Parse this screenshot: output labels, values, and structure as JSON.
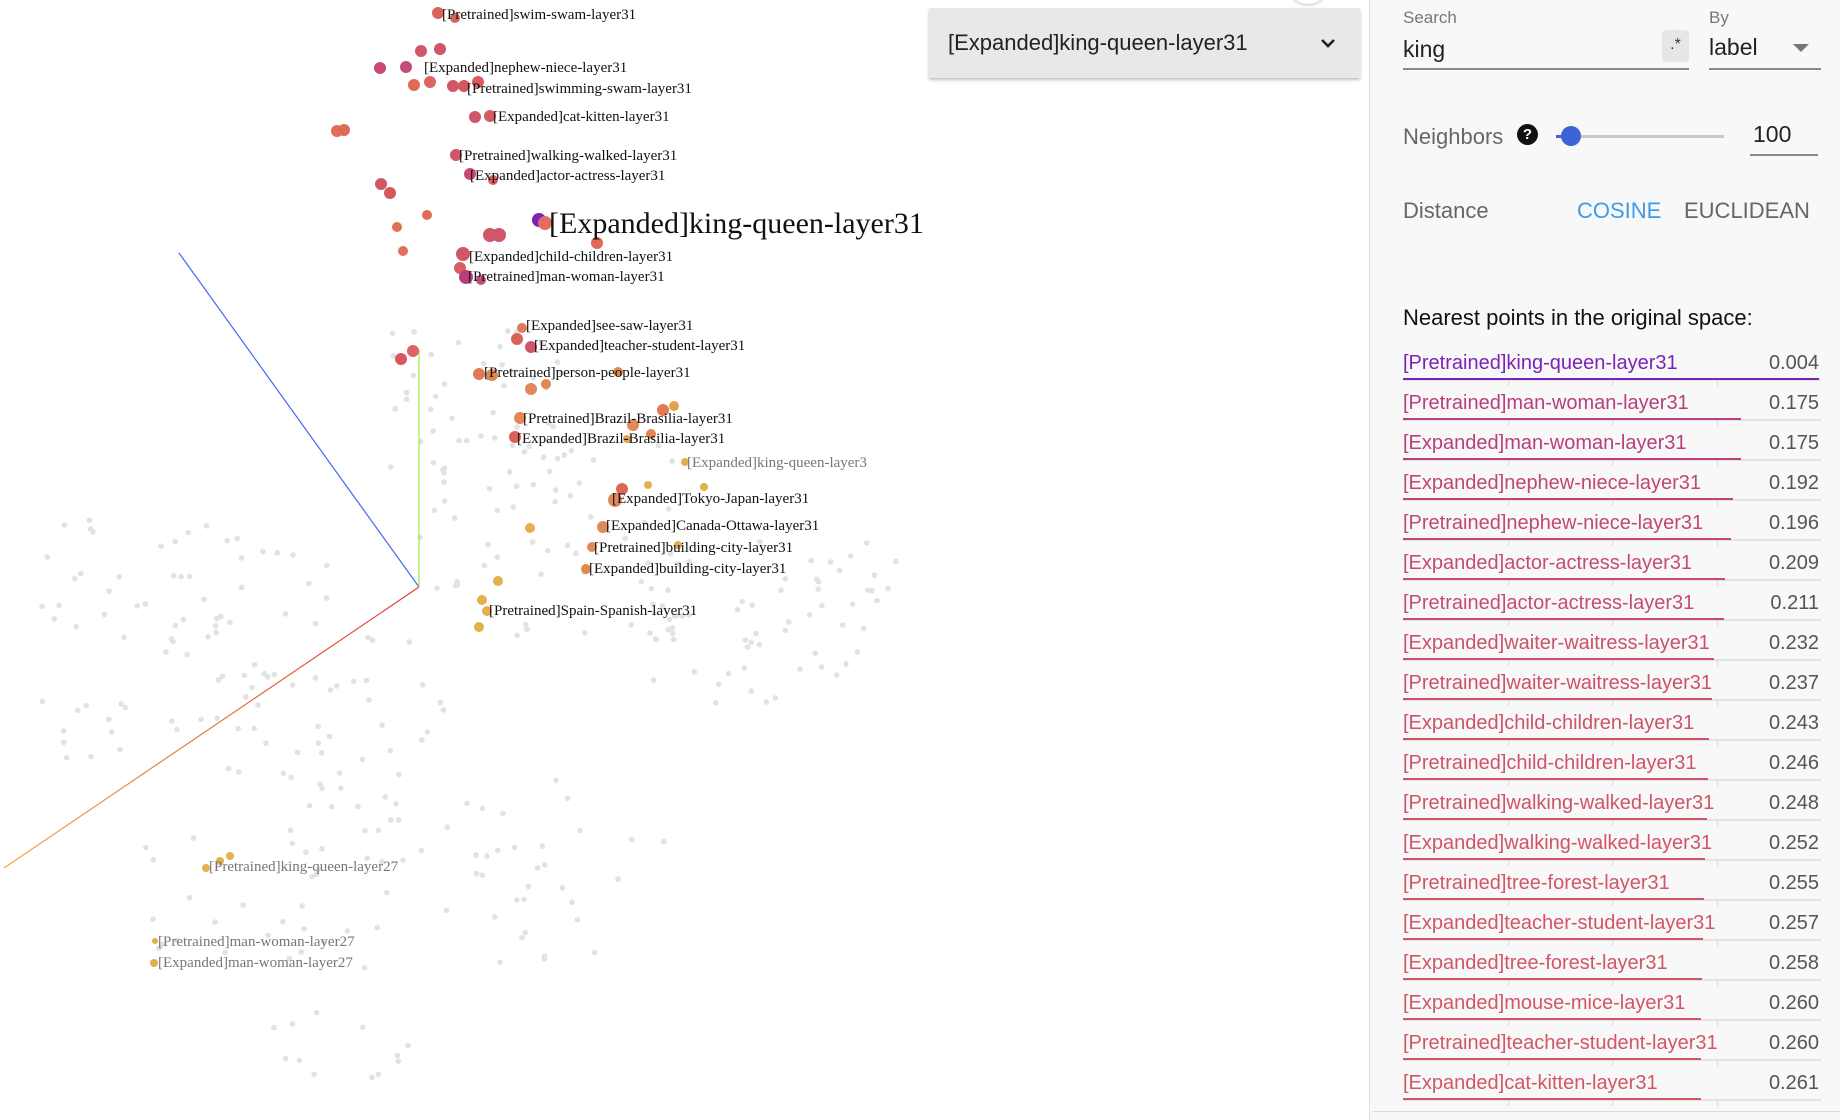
{
  "selected_point": "[Expanded]king-queen-layer31",
  "search": {
    "label": "Search",
    "value": "king",
    "regex_toggle": ".*",
    "by_label": "By",
    "by_value": "label"
  },
  "neighbors": {
    "label": "Neighbors",
    "help_icon": "?",
    "value": "100",
    "slider_fraction": 0.09
  },
  "distance": {
    "label": "Distance",
    "options": [
      "COSINE",
      "EUCLIDEAN"
    ],
    "selected": "COSINE"
  },
  "nearest": {
    "title": "Nearest points in the original space:",
    "max_distance_scale": 1.1,
    "items": [
      {
        "label": "[Pretrained]king-queen-layer31",
        "value": "0.004",
        "color": "#7b22b8"
      },
      {
        "label": "[Pretrained]man-woman-layer31",
        "value": "0.175",
        "color": "#b83e7c"
      },
      {
        "label": "[Expanded]man-woman-layer31",
        "value": "0.175",
        "color": "#b83e7c"
      },
      {
        "label": "[Expanded]nephew-niece-layer31",
        "value": "0.192",
        "color": "#bf4677"
      },
      {
        "label": "[Pretrained]nephew-niece-layer31",
        "value": "0.196",
        "color": "#c04876"
      },
      {
        "label": "[Expanded]actor-actress-layer31",
        "value": "0.209",
        "color": "#c44c72"
      },
      {
        "label": "[Pretrained]actor-actress-layer31",
        "value": "0.211",
        "color": "#c54d71"
      },
      {
        "label": "[Expanded]waiter-waitress-layer31",
        "value": "0.232",
        "color": "#cb516c"
      },
      {
        "label": "[Pretrained]waiter-waitress-layer31",
        "value": "0.237",
        "color": "#cc526b"
      },
      {
        "label": "[Expanded]child-children-layer31",
        "value": "0.243",
        "color": "#ce536a"
      },
      {
        "label": "[Pretrained]child-children-layer31",
        "value": "0.246",
        "color": "#cf5469"
      },
      {
        "label": "[Pretrained]walking-walked-layer31",
        "value": "0.248",
        "color": "#cf5469"
      },
      {
        "label": "[Expanded]walking-walked-layer31",
        "value": "0.252",
        "color": "#d05568"
      },
      {
        "label": "[Pretrained]tree-forest-layer31",
        "value": "0.255",
        "color": "#d15667"
      },
      {
        "label": "[Expanded]teacher-student-layer31",
        "value": "0.257",
        "color": "#d15667"
      },
      {
        "label": "[Expanded]tree-forest-layer31",
        "value": "0.258",
        "color": "#d15667"
      },
      {
        "label": "[Expanded]mouse-mice-layer31",
        "value": "0.260",
        "color": "#d25766"
      },
      {
        "label": "[Pretrained]teacher-student-layer31",
        "value": "0.260",
        "color": "#d25766"
      },
      {
        "label": "[Expanded]cat-kitten-layer31",
        "value": "0.261",
        "color": "#d25766"
      }
    ]
  },
  "projection_labels": [
    {
      "text": "[Pretrained]swim-swam-layer31",
      "style": "normal"
    },
    {
      "text": "[Expanded]nephew-niece-layer31",
      "style": "normal"
    },
    {
      "text": "[Pretrained]swimming-swam-layer31",
      "style": "normal"
    },
    {
      "text": "[Expanded]cat-kitten-layer31",
      "style": "normal"
    },
    {
      "text": "[Pretrained]walking-walked-layer31",
      "style": "normal"
    },
    {
      "text": "[Expanded]actor-actress-layer31",
      "style": "normal"
    },
    {
      "text": "[Expanded]king-queen-layer31",
      "style": "selected"
    },
    {
      "text": "[Expanded]child-children-layer31",
      "style": "normal"
    },
    {
      "text": "[Pretrained]man-woman-layer31",
      "style": "normal"
    },
    {
      "text": "[Expanded]see-saw-layer31",
      "style": "normal"
    },
    {
      "text": "[Expanded]teacher-student-layer31",
      "style": "normal"
    },
    {
      "text": "[Pretrained]person-people-layer31",
      "style": "normal"
    },
    {
      "text": "[Pretrained]Brazil-Brasilia-layer31",
      "style": "normal"
    },
    {
      "text": "[Expanded]Brazil-Brasilia-layer31",
      "style": "normal"
    },
    {
      "text": "[Expanded]king-queen-layer3",
      "style": "faded"
    },
    {
      "text": "[Expanded]Tokyo-Japan-layer31",
      "style": "normal"
    },
    {
      "text": "[Expanded]Canada-Ottawa-layer31",
      "style": "normal"
    },
    {
      "text": "[Pretrained]building-city-layer31",
      "style": "normal"
    },
    {
      "text": "[Expanded]building-city-layer31",
      "style": "normal"
    },
    {
      "text": "[Pretrained]Spain-Spanish-layer31",
      "style": "normal"
    },
    {
      "text": "[Pretrained]king-queen-layer27",
      "style": "faded"
    },
    {
      "text": "[Pretrained]man-woman-layer27",
      "style": "faded"
    },
    {
      "text": "[Expanded]man-woman-layer27",
      "style": "faded"
    }
  ]
}
